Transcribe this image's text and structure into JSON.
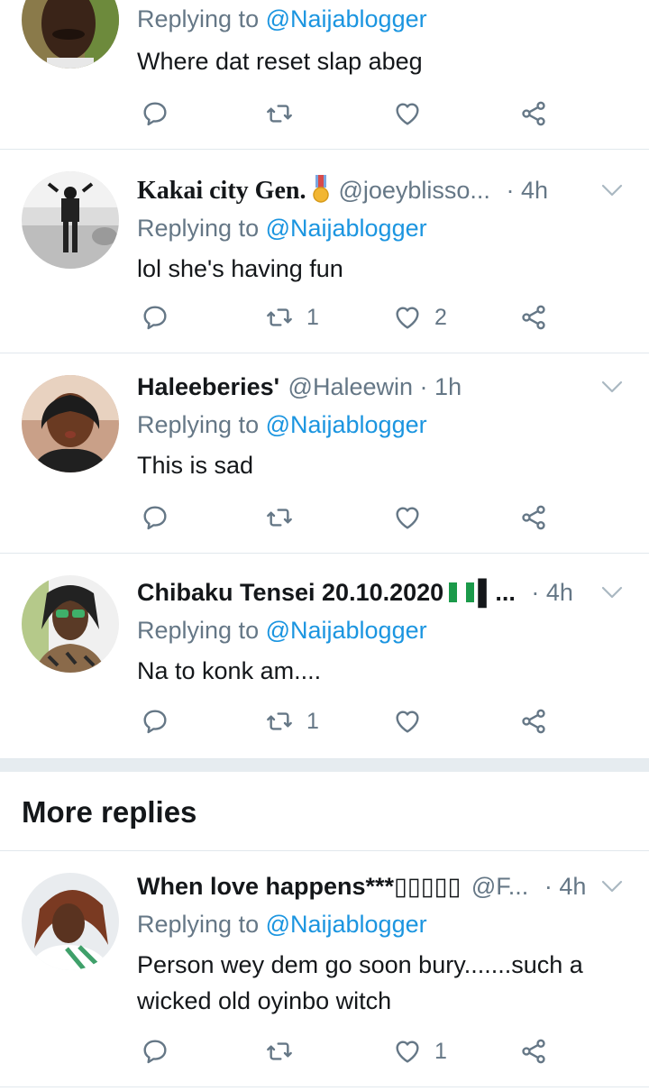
{
  "tweets": [
    {
      "name": "",
      "handle": "",
      "time": "",
      "replying_prefix": "Replying to ",
      "replying_to": "@Naijablogger",
      "text": "Where dat reset slap abeg",
      "retweets": "",
      "likes": ""
    },
    {
      "name": "Kakai city Gen.",
      "handle": "@joeyblisso...",
      "dot": "·",
      "time": "4h",
      "replying_prefix": "Replying to ",
      "replying_to": "@Naijablogger",
      "text": "lol she's having fun",
      "retweets": "1",
      "likes": "2"
    },
    {
      "name": "Haleeberies'",
      "handle": "@Haleewin",
      "dot": "·",
      "time": "1h",
      "replying_prefix": "Replying to ",
      "replying_to": "@Naijablogger",
      "text": "This is sad",
      "retweets": "",
      "likes": ""
    },
    {
      "name": "Chibaku Tensei 20.10.2020",
      "handle": "...",
      "dot": "·",
      "time": "4h",
      "replying_prefix": "Replying to ",
      "replying_to": "@Naijablogger",
      "text": "Na to konk am....",
      "retweets": "1",
      "likes": ""
    },
    {
      "name": "When love happens***▯▯▯▯▯",
      "handle": "@F...",
      "dot": "·",
      "time": "4h",
      "replying_prefix": "Replying to ",
      "replying_to": "@Naijablogger",
      "text": "Person wey dem go soon bury.......such a wicked old oyinbo witch",
      "retweets": "",
      "likes": "1"
    }
  ],
  "more_replies_label": "More replies",
  "colors": {
    "link": "#1b95e0",
    "secondary": "#657786",
    "divider": "#e1e8ed",
    "section_bg": "#e6ecf0"
  },
  "icons": [
    "reply-icon",
    "retweet-icon",
    "like-icon",
    "share-icon",
    "caret-down-icon",
    "medal-icon",
    "nigeria-flag-icon"
  ]
}
